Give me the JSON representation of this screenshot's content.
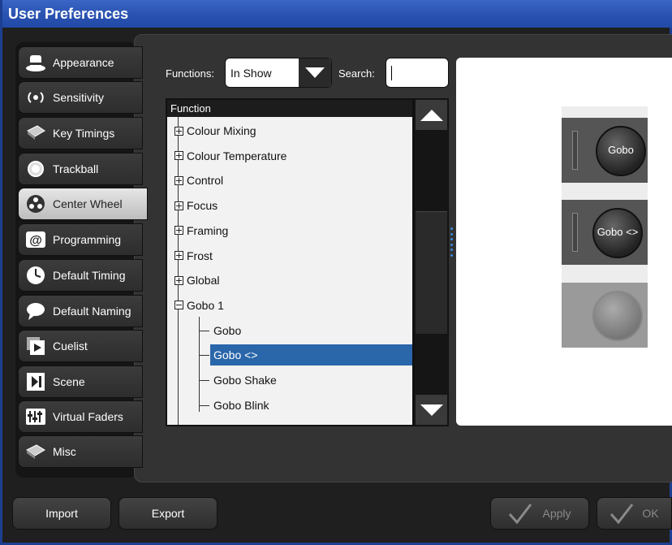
{
  "window": {
    "title": "User Preferences"
  },
  "sidebar": {
    "items": [
      {
        "label": "Appearance",
        "icon": "hat-icon"
      },
      {
        "label": "Sensitivity",
        "icon": "signal-icon"
      },
      {
        "label": "Key Timings",
        "icon": "key-icon"
      },
      {
        "label": "Trackball",
        "icon": "trackball-icon"
      },
      {
        "label": "Center Wheel",
        "icon": "wheel-icon",
        "active": true
      },
      {
        "label": "Programming",
        "icon": "programming-icon"
      },
      {
        "label": "Default Timing",
        "icon": "clock-icon"
      },
      {
        "label": "Default Naming",
        "icon": "speech-bubble-icon"
      },
      {
        "label": "Cuelist",
        "icon": "cuelist-icon"
      },
      {
        "label": "Scene",
        "icon": "scene-icon"
      },
      {
        "label": "Virtual Faders",
        "icon": "faders-icon"
      },
      {
        "label": "Misc",
        "icon": "misc-icon"
      }
    ]
  },
  "filters": {
    "functions_label": "Functions:",
    "functions_value": "In Show",
    "search_label": "Search:",
    "search_value": ""
  },
  "tree": {
    "header": "Function",
    "rows": [
      {
        "label": "Colour Mixing",
        "expander": "plus"
      },
      {
        "label": "Colour Temperature",
        "expander": "plus"
      },
      {
        "label": "Control",
        "expander": "plus"
      },
      {
        "label": "Focus",
        "expander": "plus"
      },
      {
        "label": "Framing",
        "expander": "plus"
      },
      {
        "label": "Frost",
        "expander": "plus"
      },
      {
        "label": "Global",
        "expander": "plus"
      },
      {
        "label": "Gobo 1",
        "expander": "minus"
      },
      {
        "label": "Gobo",
        "child": true
      },
      {
        "label": "Gobo <>",
        "child": true,
        "selected": true
      },
      {
        "label": "Gobo Shake",
        "child": true
      },
      {
        "label": "Gobo Blink",
        "child": true
      }
    ]
  },
  "preview": {
    "tiles": [
      {
        "label": "Gobo",
        "state": "normal"
      },
      {
        "label": "Gobo <>",
        "state": "normal"
      },
      {
        "label": "",
        "state": "disabled"
      }
    ]
  },
  "footer": {
    "import_label": "Import",
    "export_label": "Export",
    "apply_label": "Apply",
    "ok_label": "OK"
  },
  "colors": {
    "title_bar": "#2a52b0",
    "selection": "#2a66aa",
    "accent": "#3a8be0"
  }
}
